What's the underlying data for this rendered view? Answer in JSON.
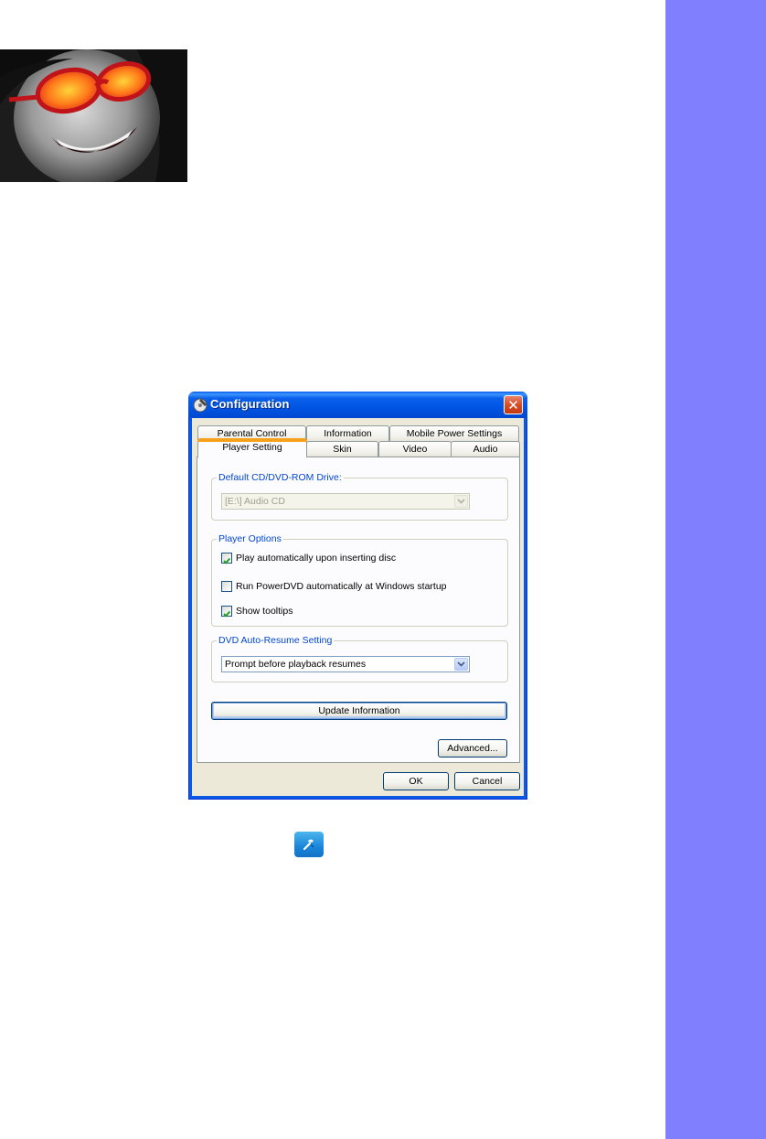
{
  "dialog": {
    "title": "Configuration",
    "close_label": "✕",
    "tabs_row1": [
      "Parental Control",
      "Information",
      "Mobile Power Settings"
    ],
    "tabs_row2": [
      "Player Setting",
      "Skin",
      "Video",
      "Audio"
    ],
    "active_tab": "Player Setting",
    "drive_group": {
      "label": "Default CD/DVD-ROM Drive:",
      "selected": "[E:\\] Audio CD"
    },
    "player_options": {
      "label": "Player Options",
      "items": [
        {
          "label": "Play automatically upon inserting disc",
          "checked": true
        },
        {
          "label": "Run PowerDVD automatically at Windows startup",
          "checked": false
        },
        {
          "label": "Show tooltips",
          "checked": true
        }
      ]
    },
    "resume_group": {
      "label": "DVD Auto-Resume Setting",
      "selected": "Prompt before playback resumes"
    },
    "update_button": "Update Information",
    "advanced_button": "Advanced...",
    "ok_button": "OK",
    "cancel_button": "Cancel"
  },
  "colors": {
    "side_bar": "#8080ff",
    "titlebar": "#0055e3",
    "group_label": "#0046d5",
    "active_tab_accent": "#f5a11c"
  },
  "icons": {
    "title": "disc-tool-icon",
    "toolbar": "configuration-icon"
  }
}
